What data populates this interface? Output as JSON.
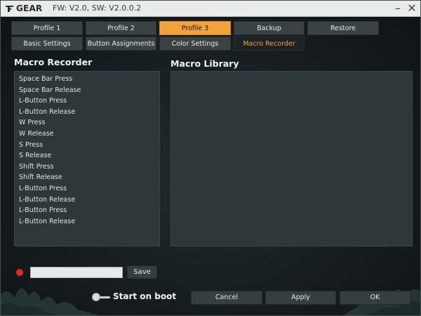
{
  "titlebar": {
    "logo_text": "GEAR",
    "version": "FW: V2.0, SW: V2.0.0.2",
    "minimize_glyph": "–",
    "close_glyph": "✕"
  },
  "tabs_row1": [
    {
      "label": "Profile 1",
      "active": false
    },
    {
      "label": "Profile 2",
      "active": false
    },
    {
      "label": "Profile 3",
      "active": true
    },
    {
      "label": "Backup",
      "active": false
    },
    {
      "label": "Restore",
      "active": false
    }
  ],
  "tabs_row2": [
    {
      "label": "Basic Settings",
      "active": false
    },
    {
      "label": "Button Assignments",
      "active": false
    },
    {
      "label": "Color Settings",
      "active": false
    },
    {
      "label": "Macro Recorder",
      "active": true
    }
  ],
  "recorder": {
    "heading": "Macro Recorder",
    "items": [
      "Space Bar Press",
      "Space Bar Release",
      "L-Button Press",
      "L-Button Release",
      "W Press",
      "W Release",
      "S Press",
      "S Release",
      "Shift Press",
      "Shift Release",
      "L-Button Press",
      "L-Button Release",
      "L-Button Press",
      "L-Button Release"
    ]
  },
  "library": {
    "heading": "Macro Library"
  },
  "record": {
    "name_value": "",
    "name_placeholder": "",
    "save_label": "Save"
  },
  "startup": {
    "label": "Start on boot",
    "enabled": false
  },
  "footer": {
    "cancel_label": "Cancel",
    "apply_label": "Apply",
    "ok_label": "OK"
  },
  "colors": {
    "accent": "#f2a23a",
    "record": "#e0262b"
  }
}
